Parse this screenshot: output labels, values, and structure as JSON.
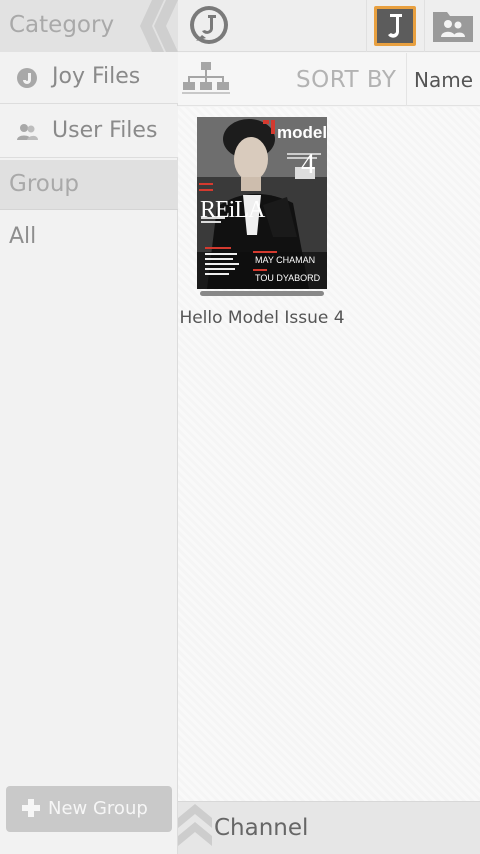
{
  "sidebar": {
    "category_label": "Category",
    "items": [
      {
        "label": "Joy Files",
        "icon": "joy-logo-icon"
      },
      {
        "label": "User Files",
        "icon": "users-icon"
      }
    ],
    "group_label": "Group",
    "group_items": [
      {
        "label": "All"
      }
    ],
    "new_group_label": "New Group"
  },
  "topbar": {
    "logo_icon": "joy-logo-icon",
    "tabs": [
      {
        "name": "joy-files-tab",
        "icon": "joy-j-icon",
        "active": true
      },
      {
        "name": "user-files-tab",
        "icon": "users-icon",
        "active": false
      }
    ]
  },
  "sortbar": {
    "icon": "hierarchy-icon",
    "sort_by_label": "SORT BY",
    "sort_value": "Name"
  },
  "books": [
    {
      "title": "Hello Model Issue 4",
      "cover": {
        "masthead": "model!",
        "issue_mark": "4",
        "cover_name": "REiLA",
        "lines": [
          "MAY CHAMAN",
          "TOU DYABORD"
        ]
      }
    }
  ],
  "bottombar": {
    "label": "Channel"
  },
  "colors": {
    "accent_orange": "#e8a040",
    "icon_grey": "#8a8a8a",
    "cover_red": "#d43a2f"
  }
}
